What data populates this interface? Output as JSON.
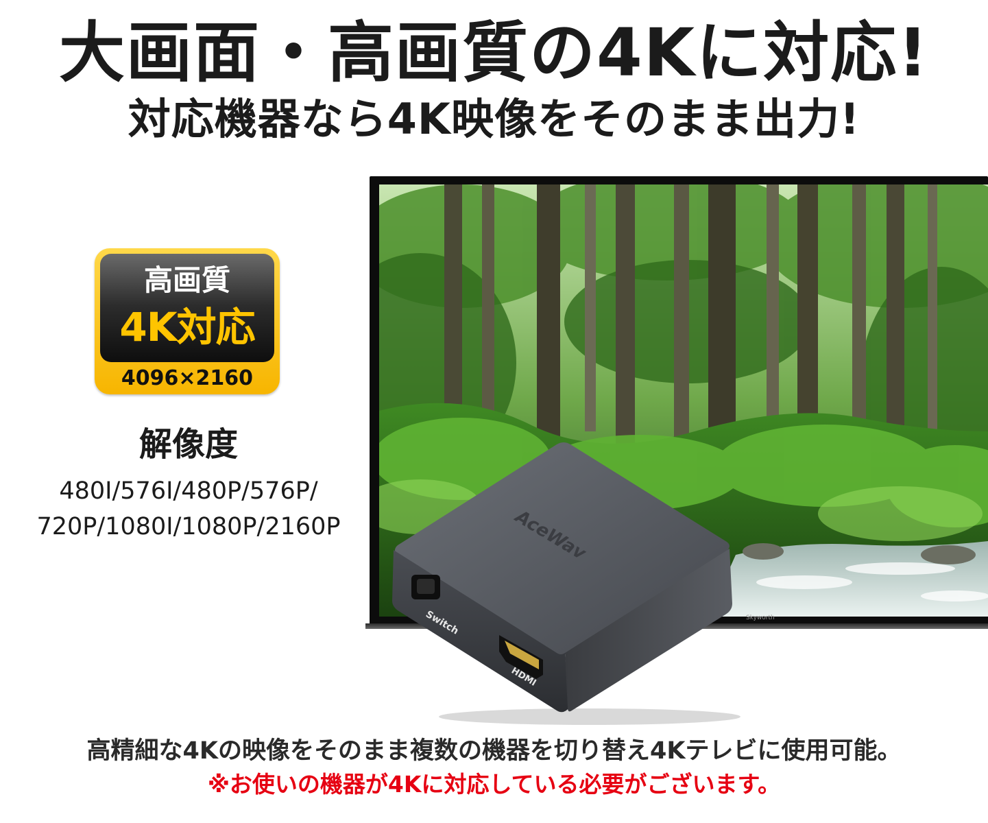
{
  "header": {
    "headline": "大画面・高画質の4Kに対応!",
    "subheadline": "対応機器なら4K映像をそのまま出力!"
  },
  "badge": {
    "title": "高画質",
    "label_4k": "4K対応",
    "resolution": "4096×2160"
  },
  "resolution_section": {
    "label": "解像度",
    "line1": "480I/576I/480P/576P/",
    "line2": "720P/1080I/1080P/2160P"
  },
  "tv": {
    "brand": "Skyworth"
  },
  "device": {
    "brand": "AceWav",
    "switch_label": "Switch",
    "port_label": "HDMI"
  },
  "footer": {
    "description": "高精細な4Kの映像をそのまま複数の機器を切り替え4Kテレビに使用可能。",
    "note": "※お使いの機器が4Kに対応している必要がございます。"
  },
  "colors": {
    "note_red": "#e60012",
    "badge_gold": "#f7b500",
    "badge_4k_text": "#ffc400"
  }
}
